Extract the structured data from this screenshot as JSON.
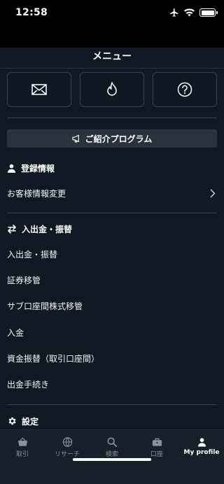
{
  "status_bar": {
    "time": "12:58"
  },
  "header": {
    "title": "メニュー"
  },
  "quick_actions": [
    {
      "icon": "mail-icon"
    },
    {
      "icon": "flame-icon"
    },
    {
      "icon": "help-icon"
    }
  ],
  "referral": {
    "label": "ご紹介プログラム",
    "icon": "megaphone-icon"
  },
  "sections": {
    "registration": {
      "title": "登録情報",
      "icon": "person-icon",
      "items": [
        {
          "label": "お客様情報変更"
        }
      ]
    },
    "transfer": {
      "title": "入出金・振替",
      "icon": "transfer-arrows-icon",
      "items": [
        {
          "label": "入出金・振替"
        },
        {
          "label": "証券移管"
        },
        {
          "label": "サブ口座間株式移管"
        },
        {
          "label": "入金"
        },
        {
          "label": "資金振替（取引口座間）"
        },
        {
          "label": "出金手続き"
        }
      ]
    },
    "settings": {
      "title": "設定",
      "icon": "gear-icon"
    }
  },
  "tabbar": {
    "tabs": [
      {
        "label": "取引",
        "icon": "basket-icon"
      },
      {
        "label": "リサーチ",
        "icon": "globe-icon"
      },
      {
        "label": "検索",
        "icon": "search-icon"
      },
      {
        "label": "口座",
        "icon": "briefcase-icon"
      },
      {
        "label": "My profile",
        "icon": "profile-icon"
      }
    ],
    "active": "My profile"
  }
}
